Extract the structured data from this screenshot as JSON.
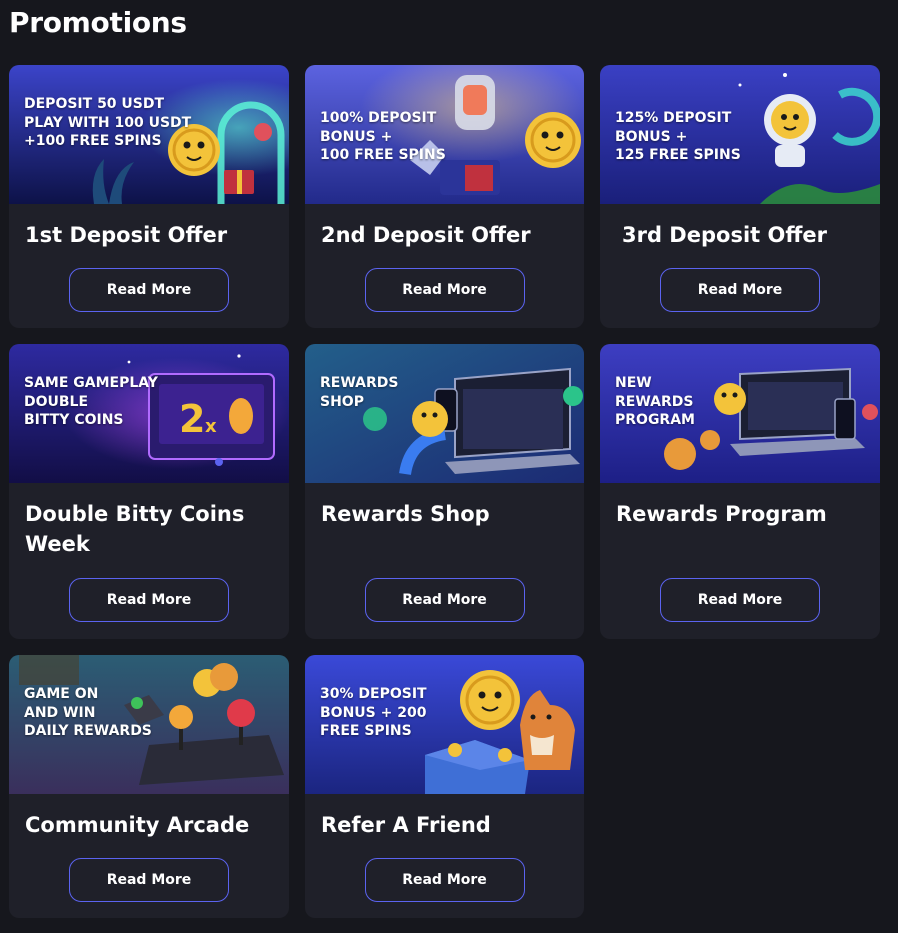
{
  "page_title": "Promotions",
  "cards": [
    {
      "banner_text": "DEPOSIT 50 USDT\nPLAY WITH 100 USDT\n+100 FREE SPINS",
      "title": "1st Deposit Offer",
      "button": "Read More",
      "colors": {
        "top": "#3b44c9",
        "bottom": "#0d1248"
      }
    },
    {
      "banner_text": "100% DEPOSIT\nBONUS +\n100 FREE SPINS",
      "title": "2nd Deposit Offer",
      "button": "Read More",
      "colors": {
        "top": "#5c63e0",
        "bottom": "#222a8a"
      }
    },
    {
      "banner_text": "125% DEPOSIT\nBONUS +\n125 FREE SPINS",
      "title": "3rd Deposit Offer",
      "button": "Read More",
      "colors": {
        "top": "#3a40c4",
        "bottom": "#1a1f7a"
      }
    },
    {
      "banner_text": "SAME GAMEPLAY\nDOUBLE\nBITTY COINS",
      "title": "Double Bitty Coins Week",
      "button": "Read More",
      "colors": {
        "top": "#2e2aa0",
        "bottom": "#120e46"
      }
    },
    {
      "banner_text": "REWARDS\nSHOP",
      "title": "Rewards Shop",
      "button": "Read More",
      "colors": {
        "top": "#235f8a",
        "bottom": "#1c2a74"
      }
    },
    {
      "banner_text": "NEW\nREWARDS\nPROGRAM",
      "title": "Rewards Program",
      "button": "Read More",
      "colors": {
        "top": "#3d3ec2",
        "bottom": "#1d1f86"
      }
    },
    {
      "banner_text": "GAME ON\nAND WIN\nDAILY REWARDS",
      "title": "Community Arcade",
      "button": "Read More",
      "colors": {
        "top": "#2b5d74",
        "bottom": "#3a2f5c"
      }
    },
    {
      "banner_text": "30% DEPOSIT\nBONUS + 200\nFREE SPINS",
      "title": "Refer A Friend",
      "button": "Read More",
      "colors": {
        "top": "#3a49d8",
        "bottom": "#1b2580"
      }
    }
  ],
  "icons": {
    "coin_mascot": "coin-mascot-icon",
    "gift": "gift-icon",
    "astronaut": "astronaut-icon",
    "laptop": "laptop-icon",
    "joystick": "joystick-icon",
    "dog": "dog-icon"
  },
  "accent_color": "#5b63f0",
  "card_bg": "#1f2029",
  "page_bg": "#16171d"
}
